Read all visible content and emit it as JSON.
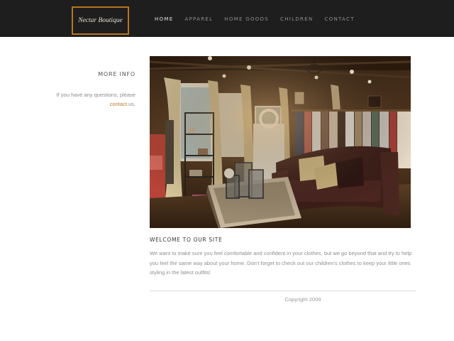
{
  "header": {
    "logo_text": "Nectar Boutique",
    "logo_border_color": "#b8741f",
    "nav": [
      {
        "label": "HOME",
        "active": true
      },
      {
        "label": "APPAREL",
        "active": false
      },
      {
        "label": "HOME GOODS",
        "active": false
      },
      {
        "label": "CHILDREN",
        "active": false
      },
      {
        "label": "CONTACT",
        "active": false
      }
    ]
  },
  "sidebar": {
    "title": "MORE INFO",
    "text_before": "If you have any questions, please",
    "link": "contact",
    "text_after": " us."
  },
  "main": {
    "photo_icon": "boutique-interior-photo",
    "welcome_title": "WELCOME TO OUR SITE",
    "welcome_text": "We want to make sure you feel comfortable and confident in your clothes, but we go beyond that and try to help you feel the same way about your home. Don't forget to check out our children's clothes to keep your little ones styling in the latest outfits!"
  },
  "footer": {
    "copyright": "Copyright 2009"
  },
  "colors": {
    "header_bg": "#1e1e1e",
    "accent": "#c0782a"
  }
}
